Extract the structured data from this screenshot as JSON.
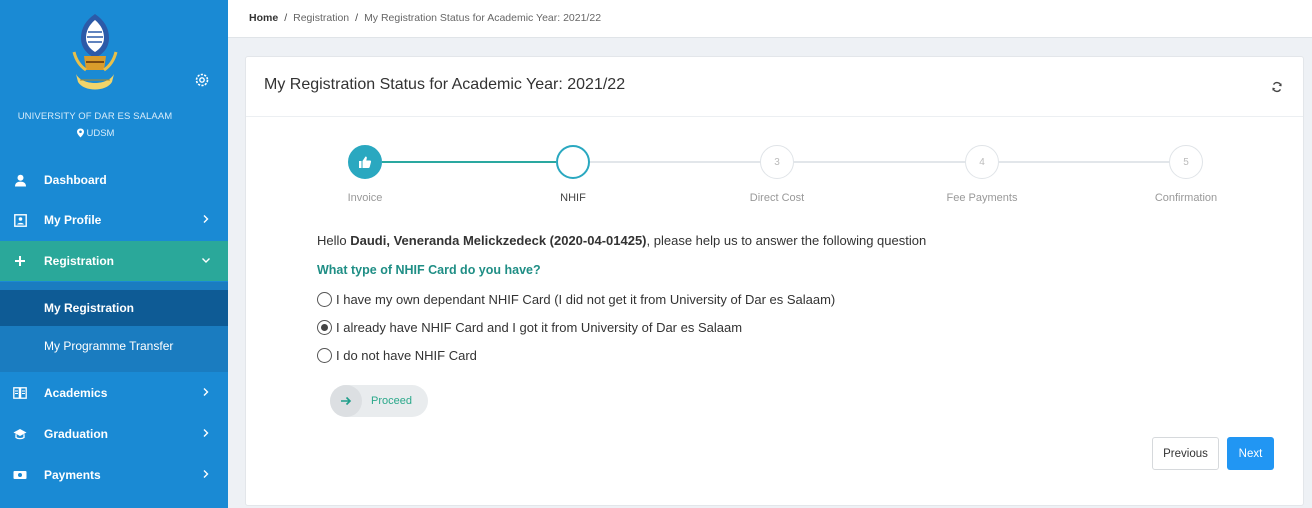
{
  "sidebar": {
    "university_name": "UNIVERSITY OF DAR ES SALAAM",
    "location": "UDSM",
    "items": [
      {
        "label": "Dashboard",
        "icon": "user-icon"
      },
      {
        "label": "My Profile",
        "icon": "id-card-icon"
      },
      {
        "label": "Registration",
        "icon": "plus-icon"
      },
      {
        "label": "Academics",
        "icon": "book-icon"
      },
      {
        "label": "Graduation",
        "icon": "graduation-cap-icon"
      },
      {
        "label": "Payments",
        "icon": "money-icon"
      }
    ],
    "sub_items": [
      {
        "label": "My Registration"
      },
      {
        "label": "My Programme Transfer"
      }
    ],
    "active_color": "#2aa89a",
    "bg_color": "#1a8ad4"
  },
  "breadcrumb": {
    "home": "Home",
    "separator": "/",
    "items": [
      "Registration",
      "My Registration Status for Academic Year: 2021/22"
    ]
  },
  "card": {
    "title": "My Registration Status for Academic Year: 2021/22"
  },
  "stepper": {
    "steps": [
      {
        "label": "Invoice",
        "number": "",
        "state": "complete"
      },
      {
        "label": "NHIF",
        "number": "",
        "state": "current"
      },
      {
        "label": "Direct Cost",
        "number": "3",
        "state": "todo"
      },
      {
        "label": "Fee Payments",
        "number": "4",
        "state": "todo"
      },
      {
        "label": "Confirmation",
        "number": "5",
        "state": "todo"
      }
    ],
    "accent_color": "#2aa8c0"
  },
  "form": {
    "greeting_prefix": "Hello ",
    "student": "Daudi, Veneranda Melickzedeck (2020-04-01425)",
    "greeting_suffix": ", please help us to answer the following question",
    "question": "What type of NHIF Card do you have?",
    "options": [
      {
        "label": "I have my own dependant NHIF Card (I did not get it from University of Dar es Salaam)",
        "checked": false
      },
      {
        "label": "I already have NHIF Card and I got it from University of Dar es Salaam",
        "checked": true
      },
      {
        "label": "I do not have NHIF Card",
        "checked": false
      }
    ],
    "proceed_label": "Proceed"
  },
  "buttons": {
    "previous": "Previous",
    "next": "Next",
    "next_color": "#2196f3"
  }
}
